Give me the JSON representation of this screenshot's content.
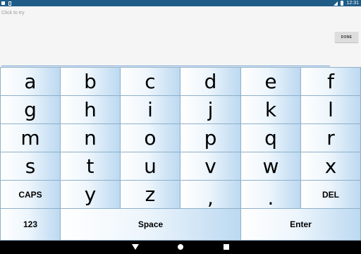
{
  "status_bar": {
    "time": "12:31"
  },
  "input": {
    "placeholder": "Click to try"
  },
  "done_button": {
    "label": "DONE"
  },
  "keyboard": {
    "rows": [
      [
        "a",
        "b",
        "c",
        "d",
        "e",
        "f"
      ],
      [
        "g",
        "h",
        "i",
        "j",
        "k",
        "l"
      ],
      [
        "m",
        "n",
        "o",
        "p",
        "q",
        "r"
      ],
      [
        "s",
        "t",
        "u",
        "v",
        "w",
        "x"
      ]
    ],
    "row5": [
      "CAPS",
      "y",
      "z",
      ",",
      ".",
      "DEL"
    ],
    "bottom": {
      "numbers": "123",
      "space": "Space",
      "enter": "Enter"
    }
  },
  "colors": {
    "status_bar": "#1e5b87",
    "key_gradient_light": "#ffffff",
    "key_gradient_dark": "#bcd9f1",
    "key_border": "#8fb0c8",
    "input_underline": "#6a9dd6"
  },
  "icons": [
    "notification-icon",
    "wifi-signal-icon",
    "battery-icon",
    "nav-back-icon",
    "nav-home-icon",
    "nav-recent-apps-icon"
  ]
}
